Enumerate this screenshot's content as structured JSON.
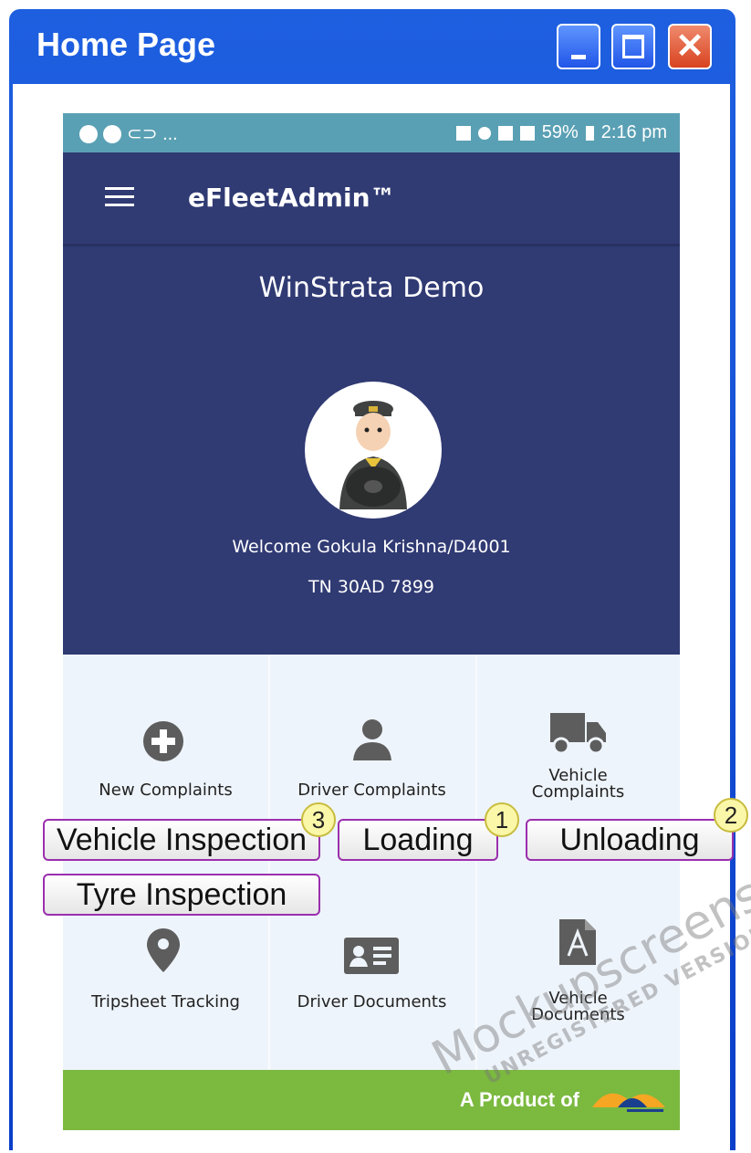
{
  "window": {
    "title": "Home Page"
  },
  "statusbar": {
    "battery": "59%",
    "time": "2:16 pm"
  },
  "appbar": {
    "title": "eFleetAdmin™"
  },
  "hero": {
    "company": "WinStrata Demo",
    "welcome": "Welcome Gokula Krishna/D4001",
    "vehicle": "TN 30AD 7899"
  },
  "tiles": {
    "new_complaints": "New Complaints",
    "driver_complaints": "Driver Complaints",
    "vehicle_complaints_1": "Vehicle",
    "vehicle_complaints_2": "Complaints",
    "tripsheet_tracking": "Tripsheet Tracking",
    "driver_documents": "Driver Documents",
    "vehicle_documents_1": "Vehicle",
    "vehicle_documents_2": "Documents"
  },
  "overlay": {
    "vehicle_inspection": "Vehicle Inspection",
    "loading": "Loading",
    "unloading": "Unloading",
    "tyre_inspection": "Tyre Inspection",
    "badge_vehicle_inspection": "3",
    "badge_loading": "1",
    "badge_unloading": "2"
  },
  "footer": {
    "text": "A Product of"
  },
  "watermark": {
    "line1": "Mockupscreens",
    "line2": "UNREGISTERED VERSION"
  },
  "icons": [
    "minimize-icon",
    "maximize-icon",
    "close-icon",
    "menu-icon",
    "add-circle-icon",
    "person-icon",
    "truck-icon",
    "location-pin-icon",
    "id-card-icon",
    "pdf-file-icon"
  ],
  "colors": {
    "appbar": "#303a73",
    "statusbar": "#5aa0b4",
    "footer": "#7bb93f",
    "window": "#0a3fc9"
  }
}
